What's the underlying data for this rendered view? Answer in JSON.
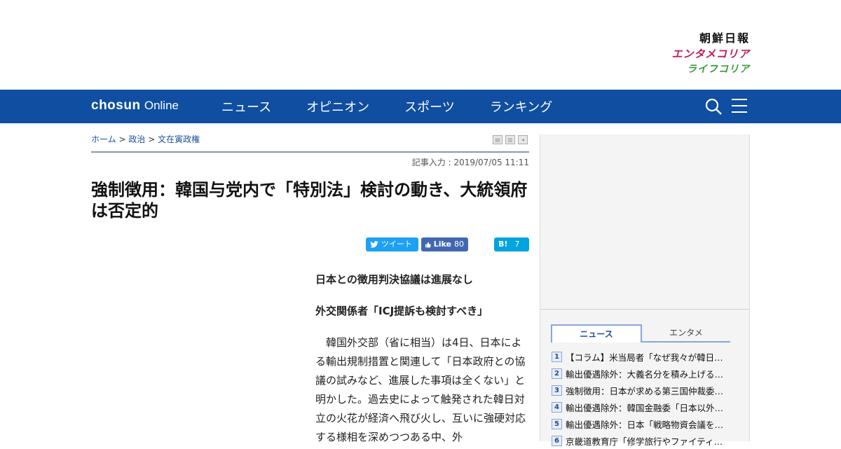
{
  "brands": [
    "朝鮮日報",
    "エンタメコリア",
    "ライフコリア"
  ],
  "nav": {
    "logo_bold": "chosun",
    "logo_light": "Online",
    "items": [
      "ニュース",
      "オピニオン",
      "スポーツ",
      "ランキング"
    ]
  },
  "breadcrumb": {
    "home": "ホーム",
    "sep1": ">",
    "cat": "政治",
    "sep2": ">",
    "sub": "文在寅政権"
  },
  "article": {
    "date": "記事入力 : 2019/07/05 11:11",
    "headline": "強制徴用：韓国与党内で「特別法」検討の動き、大統領府は否定的",
    "sub1": "日本との徴用判決協議は進展なし",
    "sub2": "外交関係者「ICJ提訴も検討すべき」",
    "body": "韓国外交部（省に相当）は4日、日本による輸出規制措置と関連して「日本政府との協議の試みなど、進展した事項は全くない」と明かした。過去史によって触発された韓日対立の火花が経済へ飛び火し、互いに強硬対応する様相を深めつつある中、外"
  },
  "share": {
    "tweet": "ツイート",
    "like": "Like",
    "like_count": "80",
    "hatena": "B!",
    "hatena_count": "7"
  },
  "sidebar": {
    "tabs": [
      "ニュース",
      "エンタメ"
    ],
    "ranking": [
      {
        "n": "1",
        "t": "【コラム】米当局者「なぜ我々が韓日…"
      },
      {
        "n": "2",
        "t": "輸出優遇除外：大義名分を積み上げる…"
      },
      {
        "n": "3",
        "t": "強制徴用：日本が求める第三国仲裁委…"
      },
      {
        "n": "4",
        "t": "輸出優遇除外：韓国金融委「日本以外…"
      },
      {
        "n": "5",
        "t": "輸出優遇除外：日本「戦略物資会議を…"
      },
      {
        "n": "6",
        "t": "京畿道教育庁「修学旅行やファイティ…"
      }
    ]
  },
  "colors": {
    "nav_bg": "#0f4ea1",
    "twitter": "#1da1f2",
    "facebook": "#4267b2",
    "hatena": "#00a4de"
  }
}
